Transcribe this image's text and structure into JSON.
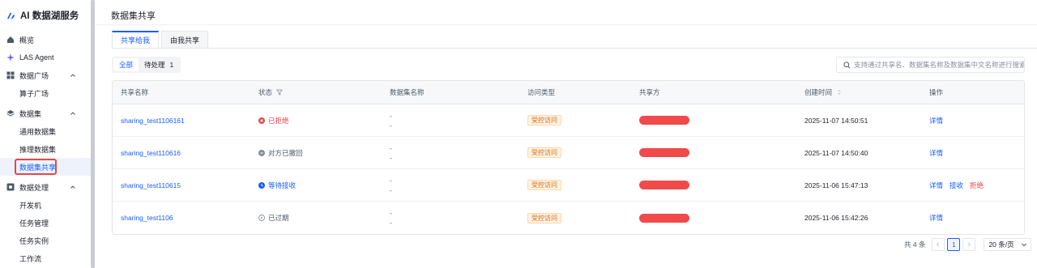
{
  "app": {
    "title": "AI 数据湖服务"
  },
  "sidebar": {
    "items": [
      {
        "label": "概览",
        "icon": "home-icon",
        "level": 0
      },
      {
        "label": "LAS Agent",
        "icon": "sparkle-icon",
        "level": 0
      },
      {
        "label": "数据广场",
        "icon": "grid-icon",
        "level": 0,
        "expanded": true
      },
      {
        "label": "算子广场",
        "level": 1
      },
      {
        "label": "数据集",
        "icon": "layers-icon",
        "level": 0,
        "expanded": true
      },
      {
        "label": "通用数据集",
        "level": 1
      },
      {
        "label": "推理数据集",
        "level": 1
      },
      {
        "label": "数据集共享",
        "level": 1,
        "active": true
      },
      {
        "label": "数据处理",
        "icon": "process-icon",
        "level": 0,
        "expanded": true
      },
      {
        "label": "开发机",
        "level": 1
      },
      {
        "label": "任务管理",
        "level": 1
      },
      {
        "label": "任务实例",
        "level": 1
      },
      {
        "label": "工作流",
        "level": 1
      }
    ]
  },
  "page": {
    "title": "数据集共享"
  },
  "tabs": [
    {
      "label": "共享给我",
      "active": true
    },
    {
      "label": "由我共享",
      "active": false
    }
  ],
  "filter": {
    "all": "全部",
    "pending": "待处理",
    "pending_count": "1"
  },
  "search": {
    "placeholder": "支持通过共享名、数据集名称及数据集中文名称进行搜索"
  },
  "table": {
    "columns": [
      "共享名称",
      "状态",
      "数据集名称",
      "访问类型",
      "共享方",
      "创建时间",
      "操作"
    ],
    "rows": [
      {
        "name": "sharing_test1106161",
        "status": "已拒绝",
        "status_icon": "rejected-icon",
        "dataset": [
          "-",
          "-"
        ],
        "access": "受控访问",
        "time": "2025-11-07 14:50:51",
        "actions": [
          "详情"
        ]
      },
      {
        "name": "sharing_test110616",
        "status": "对方已撤回",
        "status_icon": "withdrawn-icon",
        "dataset": [
          "-",
          "-"
        ],
        "access": "受控访问",
        "time": "2025-11-07 14:50:40",
        "actions": [
          "详情"
        ]
      },
      {
        "name": "sharing_test110615",
        "status": "等待接收",
        "status_icon": "pending-icon",
        "dataset": [
          "-",
          "-"
        ],
        "access": "受控访问",
        "time": "2025-11-06 15:47:13",
        "actions": [
          "详情",
          "接收",
          "拒绝"
        ]
      },
      {
        "name": "sharing_test1106",
        "status": "已过期",
        "status_icon": "expired-icon",
        "dataset": [
          "-",
          "-"
        ],
        "access": "受控访问",
        "time": "2025-11-06 15:42:26",
        "actions": [
          "详情"
        ]
      }
    ]
  },
  "pagination": {
    "total": "共 4 条",
    "current": "1",
    "page_size": "20 条/页"
  },
  "colors": {
    "primary": "#165dff",
    "danger": "#e5484d",
    "warning_tag": "#d46b08",
    "redaction": "#f04a4a"
  }
}
